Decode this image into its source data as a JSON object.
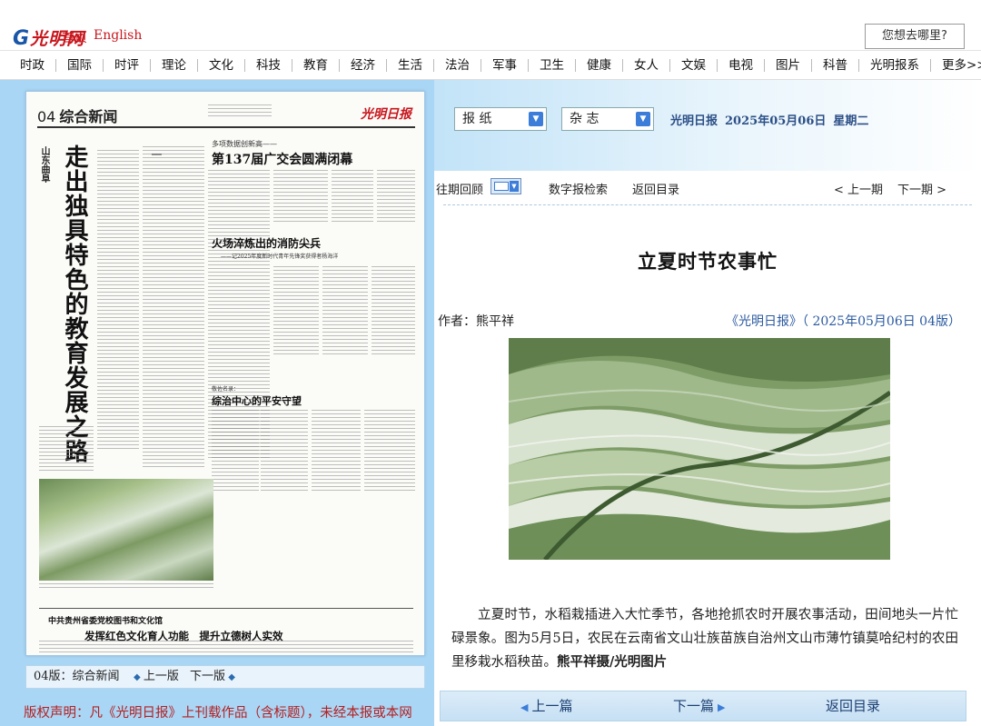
{
  "header": {
    "logo_text": "光明网",
    "home_label": "首页",
    "english_label": "English",
    "search_placeholder": "您想去哪里?"
  },
  "nav": {
    "items": [
      "时政",
      "国际",
      "时评",
      "理论",
      "文化",
      "科技",
      "教育",
      "经济",
      "生活",
      "法治",
      "军事",
      "卫生",
      "健康",
      "女人",
      "文娱",
      "电视",
      "图片",
      "科普",
      "光明报系",
      "更多>>"
    ]
  },
  "paper_pane": {
    "page_number": "04",
    "page_name": "综合新闻",
    "masthead": "光明日报",
    "kicker": "山东曲阜",
    "lead_title": "走出独具特色的教育发展之路",
    "article2_pretitle": "多项数据创新高——",
    "article2_title": "第137届广交会圆满闭幕",
    "article3_title": "火场淬炼出的消防尖兵",
    "article3_sub": "——记2025年度新时代青年先锋奖获得者杨海洋",
    "article4_pretitle": "敬佐名录：",
    "article4_title": "综治中心的平安守望",
    "bottom_kicker": "中共贵州省委党校图书和文化馆",
    "bottom_title": "发挥红色文化育人功能　提升立德树人实效",
    "footer_label": "04版：综合新闻",
    "prev_label": "上一版",
    "next_label": "下一版"
  },
  "copyright": "版权声明：凡《光明日报》上刊载作品（含标题），未经本报或本网",
  "controls": {
    "select_paper": "报 纸",
    "select_magazine": "杂 志",
    "paper_name": "光明日报",
    "date": "2025年05月06日",
    "weekday": "星期二"
  },
  "toolbar": {
    "back_issue": "往期回顾",
    "digital_search": "数字报检索",
    "back_to_index": "返回目录",
    "prev_issue": "< 上一期",
    "next_issue": "下一期 >"
  },
  "article": {
    "title": "立夏时节农事忙",
    "author": "作者：熊平祥",
    "source": "《光明日报》（ 2025年05月06日 04版）",
    "body": "立夏时节，水稻栽插进入大忙季节，各地抢抓农时开展农事活动，田间地头一片忙碌景象。图为5月5日，农民在云南省文山壮族苗族自治州文山市薄竹镇莫哈纪村的农田里移栽水稻秧苗。",
    "credit": "熊平祥摄/光明图片"
  },
  "bottom_nav": {
    "prev_article": "上一篇",
    "next_article": "下一篇",
    "back_to_index": "返回目录"
  }
}
